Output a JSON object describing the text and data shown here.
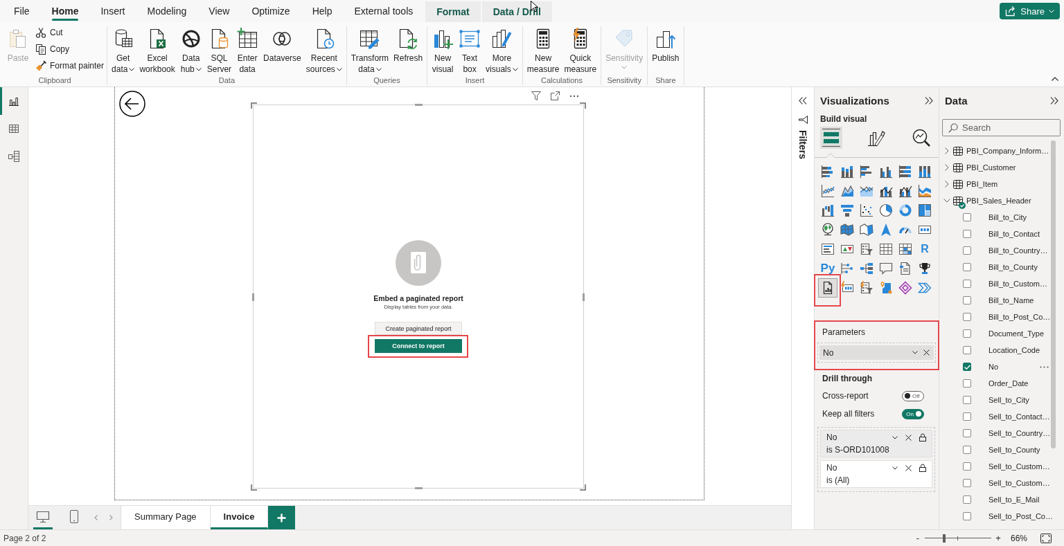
{
  "menu_tabs": [
    {
      "label": "File",
      "kind": "normal",
      "selected": false
    },
    {
      "label": "Home",
      "kind": "normal",
      "selected": true
    },
    {
      "label": "Insert",
      "kind": "normal",
      "selected": false
    },
    {
      "label": "Modeling",
      "kind": "normal",
      "selected": false
    },
    {
      "label": "View",
      "kind": "normal",
      "selected": false
    },
    {
      "label": "Optimize",
      "kind": "normal",
      "selected": false
    },
    {
      "label": "Help",
      "kind": "normal",
      "selected": false
    },
    {
      "label": "External tools",
      "kind": "normal",
      "selected": false
    },
    {
      "label": "Format",
      "kind": "contextual",
      "selected": false
    },
    {
      "label": "Data / Drill",
      "kind": "contextual",
      "selected": false
    }
  ],
  "share_button": {
    "label": "Share"
  },
  "ribbon": {
    "groups": [
      {
        "title": "Clipboard",
        "buttons": [
          {
            "kind": "paste",
            "label": "Paste",
            "disabled": true,
            "has_menu": false
          }
        ],
        "small_buttons": [
          {
            "kind": "cut",
            "label": "Cut"
          },
          {
            "kind": "copy",
            "label": "Copy"
          },
          {
            "kind": "format_painter",
            "label": "Format painter"
          }
        ]
      },
      {
        "title": "Data",
        "buttons": [
          {
            "kind": "get_data",
            "label": "Get data",
            "disabled": false,
            "has_menu": true
          },
          {
            "kind": "excel",
            "label": "Excel workbook",
            "disabled": false,
            "has_menu": false
          },
          {
            "kind": "data_hub",
            "label": "Data hub",
            "disabled": false,
            "has_menu": true
          },
          {
            "kind": "sql_server",
            "label": "SQL Server",
            "disabled": false,
            "has_menu": false
          },
          {
            "kind": "enter_data",
            "label": "Enter data",
            "disabled": false,
            "has_menu": false
          },
          {
            "kind": "dataverse",
            "label": "Dataverse",
            "disabled": false,
            "has_menu": false
          },
          {
            "kind": "recent_sources",
            "label": "Recent sources",
            "disabled": false,
            "has_menu": true
          }
        ]
      },
      {
        "title": "Queries",
        "buttons": [
          {
            "kind": "transform_data",
            "label": "Transform data",
            "disabled": false,
            "has_menu": true
          },
          {
            "kind": "refresh",
            "label": "Refresh",
            "disabled": false,
            "has_menu": false
          }
        ]
      },
      {
        "title": "Insert",
        "buttons": [
          {
            "kind": "new_visual",
            "label": "New visual",
            "disabled": false,
            "has_menu": false
          },
          {
            "kind": "text_box",
            "label": "Text box",
            "disabled": false,
            "has_menu": false
          },
          {
            "kind": "more_visuals",
            "label": "More visuals",
            "disabled": false,
            "has_menu": true
          }
        ]
      },
      {
        "title": "Calculations",
        "buttons": [
          {
            "kind": "new_measure",
            "label": "New measure",
            "disabled": false,
            "has_menu": false
          },
          {
            "kind": "quick_measure",
            "label": "Quick measure",
            "disabled": false,
            "has_menu": false
          }
        ]
      },
      {
        "title": "Sensitivity",
        "buttons": [
          {
            "kind": "sensitivity",
            "label": "Sensitivity",
            "disabled": true,
            "has_menu": true
          }
        ]
      },
      {
        "title": "Share",
        "buttons": [
          {
            "kind": "publish",
            "label": "Publish",
            "disabled": false,
            "has_menu": false
          }
        ]
      }
    ]
  },
  "view_switcher": [
    {
      "kind": "report",
      "selected": true
    },
    {
      "kind": "table",
      "selected": false
    },
    {
      "kind": "model",
      "selected": false
    }
  ],
  "report_page": {
    "visual": {
      "title": "Embed a paginated report",
      "subtitle": "Display tables from your data.",
      "buttons": [
        {
          "label": "Create paginated report",
          "kind": "secondary",
          "highlighted": false
        },
        {
          "label": "Connect to report",
          "kind": "primary",
          "highlighted": true
        }
      ]
    }
  },
  "page_navigation": {
    "layouts": [
      {
        "kind": "desktop",
        "selected": true
      },
      {
        "kind": "mobile",
        "selected": false
      }
    ],
    "tabs": [
      {
        "label": "Summary Page",
        "selected": false
      },
      {
        "label": "Invoice",
        "selected": true
      }
    ]
  },
  "filters_pane": {
    "title": "Filters"
  },
  "visualizations_pane": {
    "title": "Visualizations",
    "subtitle": "Build visual",
    "modes": [
      {
        "kind": "build",
        "selected": true
      },
      {
        "kind": "format",
        "selected": false
      },
      {
        "kind": "analytics",
        "selected": false
      }
    ],
    "visual_types": [
      {
        "kind": "stacked_bar",
        "selected": false,
        "highlighted": false
      },
      {
        "kind": "stacked_column",
        "selected": false,
        "highlighted": false
      },
      {
        "kind": "clustered_bar",
        "selected": false,
        "highlighted": false
      },
      {
        "kind": "clustered_column",
        "selected": false,
        "highlighted": false
      },
      {
        "kind": "percent_bar",
        "selected": false,
        "highlighted": false
      },
      {
        "kind": "percent_column",
        "selected": false,
        "highlighted": false
      },
      {
        "kind": "line",
        "selected": false,
        "highlighted": false
      },
      {
        "kind": "area",
        "selected": false,
        "highlighted": false
      },
      {
        "kind": "stacked_area",
        "selected": false,
        "highlighted": false
      },
      {
        "kind": "line_stacked_column",
        "selected": false,
        "highlighted": false
      },
      {
        "kind": "line_clustered_column",
        "selected": false,
        "highlighted": false
      },
      {
        "kind": "ribbon",
        "selected": false,
        "highlighted": false
      },
      {
        "kind": "waterfall",
        "selected": false,
        "highlighted": false
      },
      {
        "kind": "funnel",
        "selected": false,
        "highlighted": false
      },
      {
        "kind": "scatter",
        "selected": false,
        "highlighted": false
      },
      {
        "kind": "pie",
        "selected": false,
        "highlighted": false
      },
      {
        "kind": "donut",
        "selected": false,
        "highlighted": false
      },
      {
        "kind": "treemap",
        "selected": false,
        "highlighted": false
      },
      {
        "kind": "map",
        "selected": false,
        "highlighted": false
      },
      {
        "kind": "filled_map",
        "selected": false,
        "highlighted": false
      },
      {
        "kind": "shape_map",
        "selected": false,
        "highlighted": false
      },
      {
        "kind": "azure_map",
        "selected": false,
        "highlighted": false
      },
      {
        "kind": "gauge",
        "selected": false,
        "highlighted": false
      },
      {
        "kind": "card",
        "selected": false,
        "highlighted": false
      },
      {
        "kind": "multi_row_card",
        "selected": false,
        "highlighted": false
      },
      {
        "kind": "kpi",
        "selected": false,
        "highlighted": false
      },
      {
        "kind": "slicer",
        "selected": false,
        "highlighted": false
      },
      {
        "kind": "table",
        "selected": false,
        "highlighted": false
      },
      {
        "kind": "matrix",
        "selected": false,
        "highlighted": false
      },
      {
        "kind": "r_script",
        "label": "R",
        "selected": false,
        "highlighted": false
      },
      {
        "kind": "python",
        "label": "Py",
        "selected": false,
        "highlighted": false
      },
      {
        "kind": "key_influencers",
        "selected": false,
        "highlighted": false
      },
      {
        "kind": "decomposition_tree",
        "selected": false,
        "highlighted": false
      },
      {
        "kind": "qna",
        "selected": false,
        "highlighted": false
      },
      {
        "kind": "narrative",
        "selected": false,
        "highlighted": false
      },
      {
        "kind": "goals",
        "selected": false,
        "highlighted": false
      },
      {
        "kind": "paginated",
        "selected": true,
        "highlighted": true
      },
      {
        "kind": "card_new",
        "selected": false,
        "highlighted": false
      },
      {
        "kind": "slicer_new",
        "selected": false,
        "highlighted": false
      },
      {
        "kind": "map_app",
        "selected": false,
        "highlighted": false
      },
      {
        "kind": "power_apps",
        "selected": false,
        "highlighted": false
      },
      {
        "kind": "power_automate",
        "selected": false,
        "highlighted": false
      }
    ],
    "wells": [
      {
        "title": "Parameters",
        "highlighted": true,
        "fields": [
          {
            "name": "No"
          }
        ]
      }
    ],
    "drill_through": {
      "title": "Drill through",
      "toggles": [
        {
          "label": "Cross-report",
          "on": false,
          "state_text": "Off"
        },
        {
          "label": "Keep all filters",
          "on": true,
          "state_text": "On"
        }
      ],
      "filters": [
        {
          "field": "No",
          "condition": "is S-ORD101008",
          "selected": true
        },
        {
          "field": "No",
          "condition": "is (All)",
          "selected": false
        }
      ]
    }
  },
  "data_pane": {
    "title": "Data",
    "search": {
      "placeholder": "Search"
    },
    "tables": [
      {
        "name": "PBI_Company_Inform…",
        "expanded": false,
        "in_use": false
      },
      {
        "name": "PBI_Customer",
        "expanded": false,
        "in_use": false
      },
      {
        "name": "PBI_Item",
        "expanded": false,
        "in_use": false
      },
      {
        "name": "PBI_Sales_Header",
        "expanded": true,
        "in_use": true,
        "children": [
          {
            "name": "Bill_to_City",
            "checked": false,
            "hovered": false
          },
          {
            "name": "Bill_to_Contact",
            "checked": false,
            "hovered": false
          },
          {
            "name": "Bill_to_Country…",
            "checked": false,
            "hovered": false
          },
          {
            "name": "Bill_to_County",
            "checked": false,
            "hovered": false
          },
          {
            "name": "Bill_to_Custom…",
            "checked": false,
            "hovered": false
          },
          {
            "name": "Bill_to_Name",
            "checked": false,
            "hovered": false
          },
          {
            "name": "Bill_to_Post_Co…",
            "checked": false,
            "hovered": false
          },
          {
            "name": "Document_Type",
            "checked": false,
            "hovered": false
          },
          {
            "name": "Location_Code",
            "checked": false,
            "hovered": false
          },
          {
            "name": "No",
            "checked": true,
            "hovered": true
          },
          {
            "name": "Order_Date",
            "checked": false,
            "hovered": false
          },
          {
            "name": "Sell_to_City",
            "checked": false,
            "hovered": false
          },
          {
            "name": "Sell_to_Contact…",
            "checked": false,
            "hovered": false
          },
          {
            "name": "Sell_to_Country…",
            "checked": false,
            "hovered": false
          },
          {
            "name": "Sell_to_County",
            "checked": false,
            "hovered": false
          },
          {
            "name": "Sell_to_Custom…",
            "checked": false,
            "hovered": false
          },
          {
            "name": "Sell_to_Custom…",
            "checked": false,
            "hovered": false
          },
          {
            "name": "Sell_to_E_Mail",
            "checked": false,
            "hovered": false
          },
          {
            "name": "Sell_to_Post_Co…",
            "checked": false,
            "hovered": false
          }
        ]
      }
    ]
  },
  "status_bar": {
    "page_label": "Page 2 of 2",
    "zoom_out": "-",
    "zoom_in": "+",
    "zoom": {
      "level": 0.29,
      "reading": "66%"
    }
  }
}
